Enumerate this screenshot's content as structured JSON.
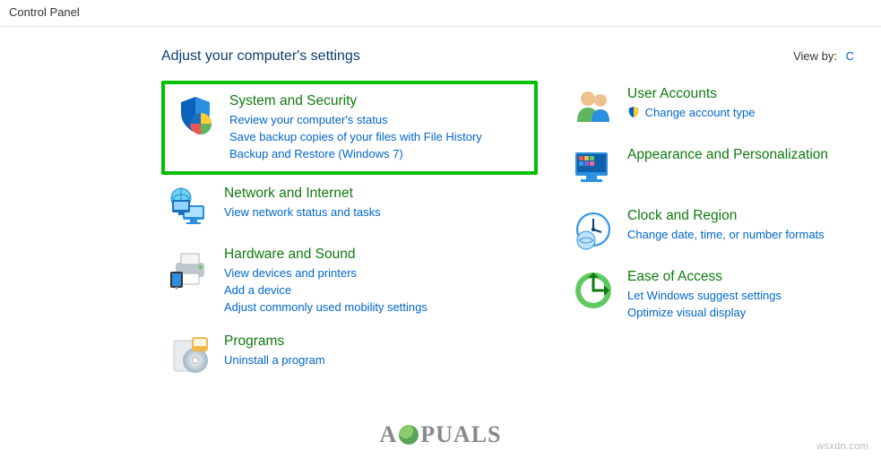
{
  "window": {
    "title": "Control Panel"
  },
  "header": {
    "heading": "Adjust your computer's settings",
    "viewby_label": "View by:",
    "viewby_value": "C"
  },
  "left": [
    {
      "id": "system-security",
      "title": "System and Security",
      "links": [
        "Review your computer's status",
        "Save backup copies of your files with File History",
        "Backup and Restore (Windows 7)"
      ],
      "highlight": true,
      "icon": "shield"
    },
    {
      "id": "network-internet",
      "title": "Network and Internet",
      "links": [
        "View network status and tasks"
      ],
      "icon": "network"
    },
    {
      "id": "hardware-sound",
      "title": "Hardware and Sound",
      "links": [
        "View devices and printers",
        "Add a device",
        "Adjust commonly used mobility settings"
      ],
      "icon": "printer"
    },
    {
      "id": "programs",
      "title": "Programs",
      "links": [
        "Uninstall a program"
      ],
      "icon": "disc"
    }
  ],
  "right": [
    {
      "id": "user-accounts",
      "title": "User Accounts",
      "links": [
        "Change account type"
      ],
      "link_icons": [
        "shield-small"
      ],
      "icon": "users"
    },
    {
      "id": "appearance-personalization",
      "title": "Appearance and Personalization",
      "links": [],
      "icon": "appearance"
    },
    {
      "id": "clock-region",
      "title": "Clock and Region",
      "links": [
        "Change date, time, or number formats"
      ],
      "icon": "clock"
    },
    {
      "id": "ease-of-access",
      "title": "Ease of Access",
      "links": [
        "Let Windows suggest settings",
        "Optimize visual display"
      ],
      "icon": "ease"
    }
  ],
  "watermark_right": "wsxdn.com",
  "watermark_center_pre": "A",
  "watermark_center_post": "PUALS"
}
